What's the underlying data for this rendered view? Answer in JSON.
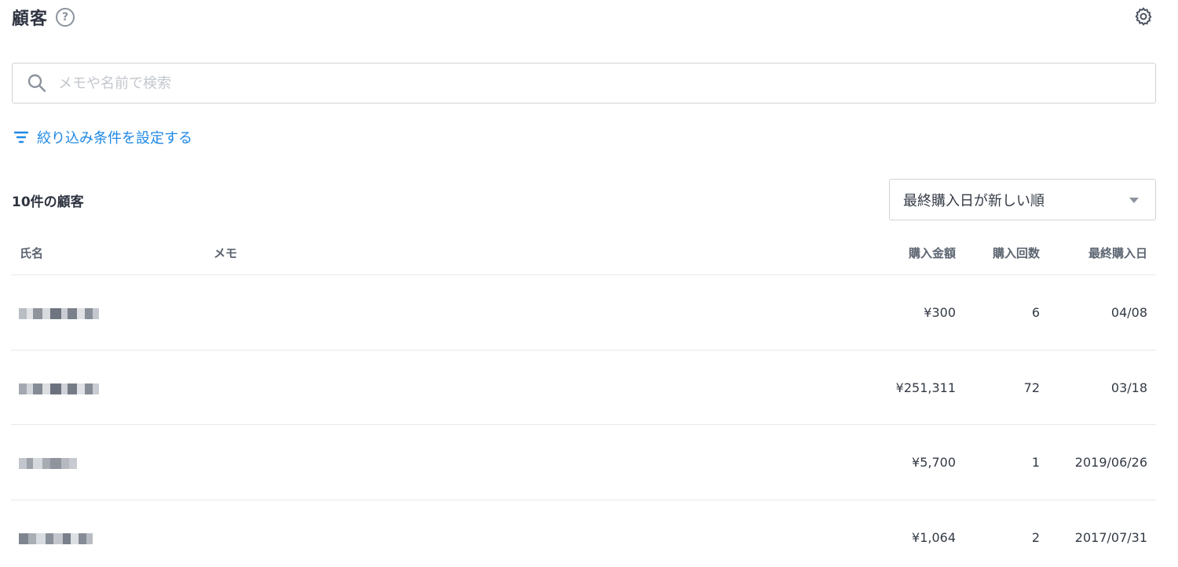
{
  "header": {
    "title": "顧客",
    "help_icon": "?",
    "icons": {
      "help": "help-circle-icon",
      "settings": "gear-icon"
    }
  },
  "search": {
    "placeholder": "メモや名前で検索",
    "value": "",
    "icon": "search-icon"
  },
  "filter": {
    "label": "絞り込み条件を設定する",
    "icon": "filter-icon",
    "color": "#1e88e5"
  },
  "results": {
    "count_label": "10件の顧客"
  },
  "sort": {
    "selected": "最終購入日が新しい順",
    "icon": "chevron-down-icon"
  },
  "table": {
    "columns": {
      "name": "氏名",
      "memo": "メモ",
      "amount": "購入金額",
      "count": "購入回数",
      "last_purchase": "最終購入日"
    },
    "rows": [
      {
        "memo": "",
        "amount": "¥300",
        "count": "6",
        "last_purchase": "04/08"
      },
      {
        "memo": "",
        "amount": "¥251,311",
        "count": "72",
        "last_purchase": "03/18"
      },
      {
        "memo": "",
        "amount": "¥5,700",
        "count": "1",
        "last_purchase": "2019/06/26"
      },
      {
        "memo": "",
        "amount": "¥1,064",
        "count": "2",
        "last_purchase": "2017/07/31"
      }
    ]
  }
}
